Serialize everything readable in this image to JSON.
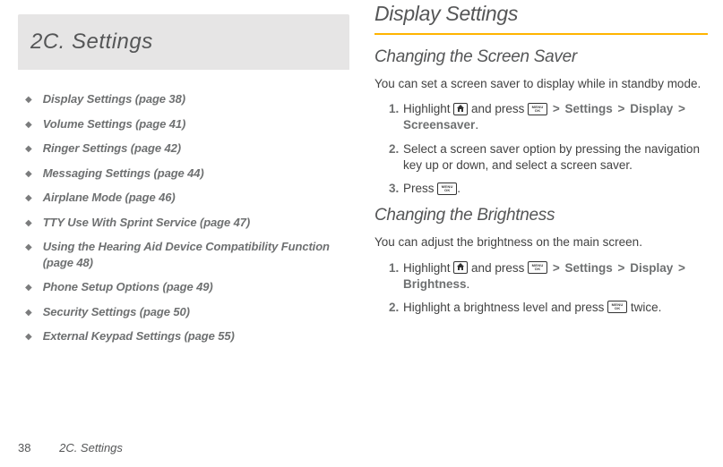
{
  "section_tab": "2C. Settings",
  "toc": [
    "Display Settings (page 38)",
    "Volume Settings (page 41)",
    "Ringer Settings (page 42)",
    "Messaging Settings (page 44)",
    "Airplane Mode (page 46)",
    "TTY Use With Sprint Service (page 47)",
    "Using the Hearing Aid Device Compatibility Function (page 48)",
    "Phone Setup Options (page 49)",
    "Security Settings (page 50)",
    "External Keypad Settings (page 55)"
  ],
  "right": {
    "h1": "Display Settings",
    "screensaver": {
      "h2": "Changing the Screen Saver",
      "intro": "You can set a screen saver to display while in standby mode.",
      "step1_a": "Highlight ",
      "step1_b": " and press ",
      "step1_settings": "Settings",
      "step1_display": "Display",
      "step1_screensaver": "Screensaver",
      "step2": "Select a screen saver option by pressing the navigation key up or down, and select a screen saver.",
      "step3_a": "Press ",
      "step3_b": "."
    },
    "brightness": {
      "h2": "Changing the Brightness",
      "intro": "You can adjust the brightness on the main screen.",
      "step1_a": "Highlight ",
      "step1_b": " and press ",
      "step1_settings": "Settings",
      "step1_display": "Display",
      "step1_brightness": "Brightness",
      "step2_a": "Highlight a brightness level and press ",
      "step2_b": " twice."
    }
  },
  "footer": {
    "page_number": "38",
    "section": "2C. Settings"
  },
  "icons": {
    "home": "home-icon",
    "menu_ok": "menu-ok-icon"
  }
}
